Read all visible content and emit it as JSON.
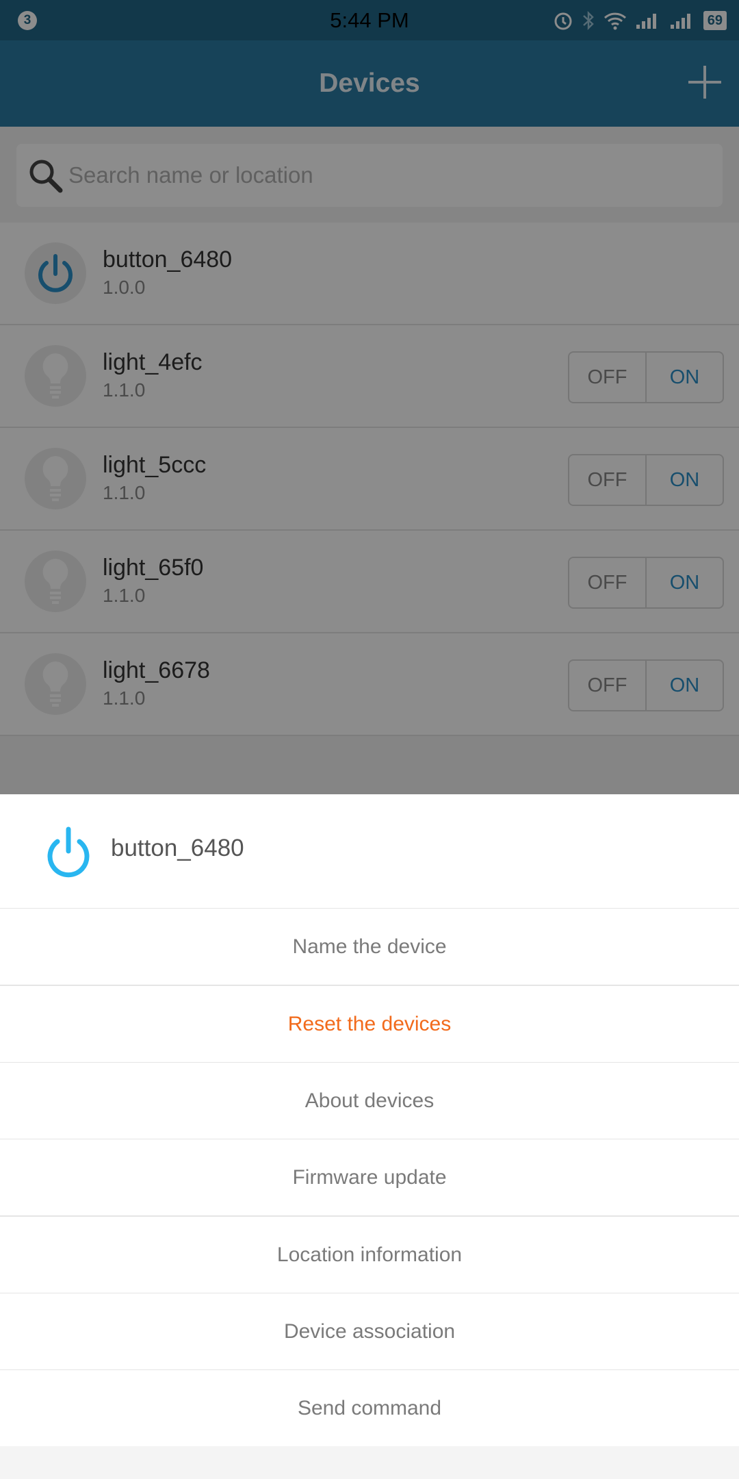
{
  "status_bar": {
    "notification_count": "3",
    "time": "5:44 PM",
    "battery": "69"
  },
  "app_bar": {
    "title": "Devices"
  },
  "search": {
    "placeholder": "Search name or location"
  },
  "devices": [
    {
      "name": "button_6480",
      "version": "1.0.0",
      "icon": "power-icon"
    },
    {
      "name": "light_4efc",
      "version": "1.1.0",
      "icon": "light-bulb-icon",
      "off_label": "OFF",
      "on_label": "ON"
    },
    {
      "name": "light_5ccc",
      "version": "1.1.0",
      "icon": "light-bulb-icon",
      "off_label": "OFF",
      "on_label": "ON"
    },
    {
      "name": "light_65f0",
      "version": "1.1.0",
      "icon": "light-bulb-icon",
      "off_label": "OFF",
      "on_label": "ON"
    },
    {
      "name": "light_6678",
      "version": "1.1.0",
      "icon": "light-bulb-icon",
      "off_label": "OFF",
      "on_label": "ON"
    }
  ],
  "sheet": {
    "title": "button_6480",
    "items": [
      "Name the device",
      "Reset  the  devices",
      "About devices",
      "Firmware update",
      "Location information",
      "Device association",
      "Send command"
    ]
  },
  "colors": {
    "app_bar": "#2b7aa3",
    "status_bar": "#216688",
    "accent": "#2b8fc6",
    "sheet_icon": "#29b6f0",
    "danger": "#f26a1b"
  }
}
